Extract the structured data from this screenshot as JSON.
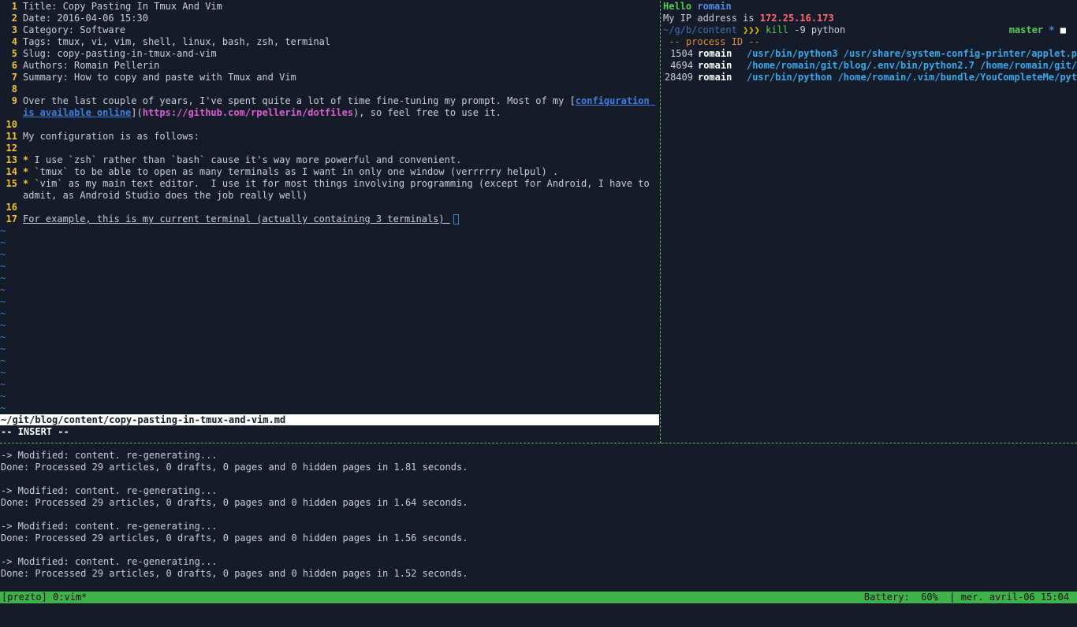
{
  "vim": {
    "lines": [
      {
        "n": "1",
        "text": "Title: Copy Pasting In Tmux And Vim"
      },
      {
        "n": "2",
        "text": "Date: 2016-04-06 15:30"
      },
      {
        "n": "3",
        "text": "Category: Software"
      },
      {
        "n": "4",
        "text": "Tags: tmux, vi, vim, shell, linux, bash, zsh, terminal"
      },
      {
        "n": "5",
        "text": "Slug: copy-pasting-in-tmux-and-vim"
      },
      {
        "n": "6",
        "text": "Authors: Romain Pellerin"
      },
      {
        "n": "7",
        "text": "Summary: How to copy and paste with Tmux and Vim"
      },
      {
        "n": "8",
        "text": ""
      },
      {
        "n": "9",
        "pre": "Over the last couple of years, I've spent quite a lot of time fine-tuning my prompt. Most of my [",
        "link": "configuration is available online",
        "mid": "](",
        "url": "https://github.com/rpellerin/dotfiles",
        "post": "), so feel free to use it."
      },
      {
        "n": "10",
        "text": ""
      },
      {
        "n": "11",
        "text": "My configuration is as follows:"
      },
      {
        "n": "12",
        "text": ""
      },
      {
        "n": "13",
        "bullet": "*",
        "text": " I use `zsh` rather than `bash` cause it's way more powerful and convenient."
      },
      {
        "n": "14",
        "bullet": "*",
        "text": " `tmux` to be able to open as many terminals as I want in only one window (verrrrry helpul) ."
      },
      {
        "n": "15",
        "bullet": "*",
        "text": " `vim` as my main text editor.  I use it for most things involving programming (except for Android, I have to admit, as Android Studio does the job really well)"
      },
      {
        "n": "16",
        "text": ""
      },
      {
        "n": "17",
        "text": "For example, this is my current terminal (actually containing 3 terminals) "
      }
    ],
    "tilde": "~",
    "status_file": "~/git/blog/content/copy-pasting-in-tmux-and-vim.md",
    "mode": "-- INSERT --"
  },
  "shell": {
    "hello": "Hello",
    "user": "romain",
    "ip_label": "My IP address is",
    "ip": "172.25.16.173",
    "cwd": "~/g/b/content",
    "arrows": "❯❯❯",
    "command": "kill",
    "args": "-9 python",
    "branch": "master",
    "git_star": "*",
    "git_square": "■",
    "process_header": "-- process ID --",
    "processes": [
      {
        "pid": "1504",
        "user": "romain",
        "cmd": "/usr/bin/python3 /usr/share/system-config-printer/applet.p"
      },
      {
        "pid": "4694",
        "user": "romain",
        "cmd": "/home/romain/git/blog/.env/bin/python2.7 /home/romain/git/"
      },
      {
        "pid": "28409",
        "user": "romain",
        "cmd": "/usr/bin/python /home/romain/.vim/bundle/YouCompleteMe/pyt"
      }
    ]
  },
  "log": {
    "lines": [
      "-> Modified: content. re-generating...",
      "Done: Processed 29 articles, 0 drafts, 0 pages and 0 hidden pages in 1.81 seconds.",
      "",
      "-> Modified: content. re-generating...",
      "Done: Processed 29 articles, 0 drafts, 0 pages and 0 hidden pages in 1.64 seconds.",
      "",
      "-> Modified: content. re-generating...",
      "Done: Processed 29 articles, 0 drafts, 0 pages and 0 hidden pages in 1.56 seconds.",
      "",
      "-> Modified: content. re-generating...",
      "Done: Processed 29 articles, 0 drafts, 0 pages and 0 hidden pages in 1.52 seconds."
    ]
  },
  "tmux": {
    "left": "[prezto] 0:vim*",
    "right": "Battery:  60%  | mer. avril-06 15:04"
  }
}
